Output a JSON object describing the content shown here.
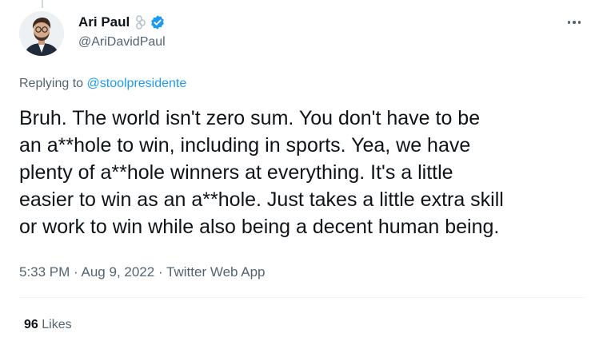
{
  "author": {
    "name": "Ari Paul",
    "handle": "@AriDavidPaul"
  },
  "reply": {
    "prefix": "Replying to",
    "to": "@stoolpresidente"
  },
  "tweet": {
    "text": "Bruh.  The world isn't zero sum.  You don't have to be\nan a**hole to win, including in sports.  Yea, we have\nplenty of a**hole winners at everything.  It's a little\neasier to win as an a**hole.  Just takes a little extra skill\nor work to win while also being a decent human being.",
    "time": "5:33 PM",
    "date": "Aug 9, 2022",
    "source": "Twitter Web App",
    "separator": "·"
  },
  "stats": {
    "likes_count": "96",
    "likes_label": "Likes"
  },
  "icons": {
    "more": "more-icon",
    "verified": "verified-badge-icon",
    "chain": "chain-link-icon"
  },
  "colors": {
    "accent": "#1d9bf0",
    "text": "#0f1419",
    "secondary": "#536471"
  }
}
